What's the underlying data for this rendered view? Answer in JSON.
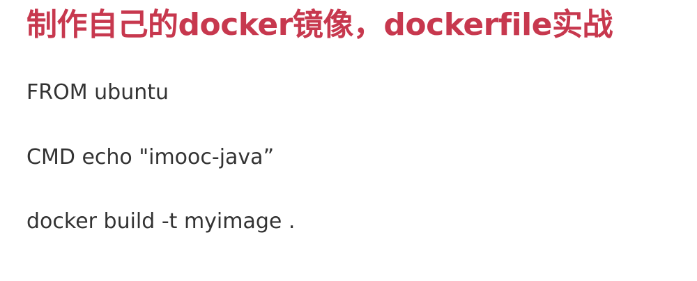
{
  "article": {
    "title": "制作自己的docker镜像，dockerfile实战",
    "lines": [
      "FROM ubuntu",
      "CMD echo \"imooc-java”",
      "docker build -t myimage ."
    ]
  },
  "colors": {
    "title": "#c7384e",
    "text": "#333333",
    "background": "#ffffff"
  }
}
